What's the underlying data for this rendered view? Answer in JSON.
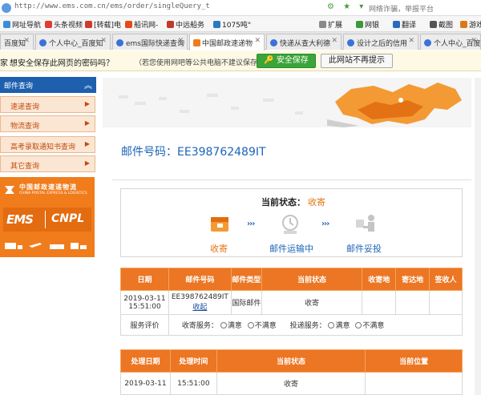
{
  "address_bar": {
    "url": "http://www.ems.com.cn/ems/order/singleQuery_t",
    "right_text": "网络诈骗，举报平台"
  },
  "bookmarks": [
    {
      "label": "网址导航",
      "color": "#3b8cdb"
    },
    {
      "label": "头条视频",
      "color": "#e03c31"
    },
    {
      "label": "[转载]电",
      "color": "#d03a2a"
    },
    {
      "label": "船讯网-",
      "color": "#e64a19"
    },
    {
      "label": "中远船务",
      "color": "#c0392b"
    },
    {
      "label": "1075吨\"",
      "color": "#2a7ac0"
    },
    {
      "label": "扩展",
      "color": "#8a8a8a"
    },
    {
      "label": "网银",
      "color": "#3a9a3a"
    },
    {
      "label": "翻译",
      "color": "#2a6ac0"
    },
    {
      "label": "截图",
      "color": "#555555"
    },
    {
      "label": "游戏",
      "color": "#d97a1a"
    }
  ],
  "tabs": [
    {
      "label": "百度知",
      "active": false
    },
    {
      "label": "个人中心_百度知",
      "active": false
    },
    {
      "label": "ems国际快递查询",
      "active": false
    },
    {
      "label": "中国邮政速递物",
      "active": true
    },
    {
      "label": "快递从查大利德",
      "active": false
    },
    {
      "label": "设计之后的信用",
      "active": false
    },
    {
      "label": "个人中心_百度知",
      "active": false
    }
  ],
  "password_bar": {
    "question": "想安全保存此网页的密码吗？",
    "hint": "（若您使用网吧等公共电脑不建议保存）",
    "save_label": "安全保存",
    "never_label": "此网站不再提示",
    "prefix": "家"
  },
  "sidebar": {
    "header": "邮件查询",
    "items": [
      "速递查询",
      "物流查询",
      "高考录取通知书查询",
      "其它查询"
    ],
    "logo_cn": "中国邮政速递物流",
    "logo_en": "CHINA POSTAL EXPRESS & LOGISTICS",
    "ems_text": "EMS",
    "cnpl_text": "CNPL"
  },
  "main": {
    "title_label": "邮件号码：",
    "tracking_number": "EE398762489IT",
    "status_label": "当前状态：",
    "status_value": "收寄",
    "steps": [
      "收寄",
      "邮件运输中",
      "邮件妥投"
    ],
    "accent_color": "#e47414",
    "inactive_color": "#1c64b8"
  },
  "table1": {
    "headers": [
      "日期",
      "邮件号码",
      "邮件类型",
      "当前状态",
      "收寄地",
      "寄达地",
      "签收人"
    ],
    "row": {
      "date": "2019-03-11 15:51:00",
      "number": "EE398762489IT",
      "recall": "收起",
      "type": "国际邮件",
      "status": "收寄",
      "origin": "",
      "dest": "",
      "signer": ""
    },
    "rating": {
      "label": "服务评价",
      "receive_label": "收寄服务：",
      "deliver_label": "投递服务：",
      "satisfied": "满意",
      "unsatisfied": "不满意"
    }
  },
  "table2": {
    "headers": [
      "处理日期",
      "处理时间",
      "当前状态",
      "当前位置"
    ],
    "rows": [
      {
        "date": "2019-03-11",
        "time": "15:51:00",
        "status": "收寄",
        "location": ""
      }
    ]
  }
}
